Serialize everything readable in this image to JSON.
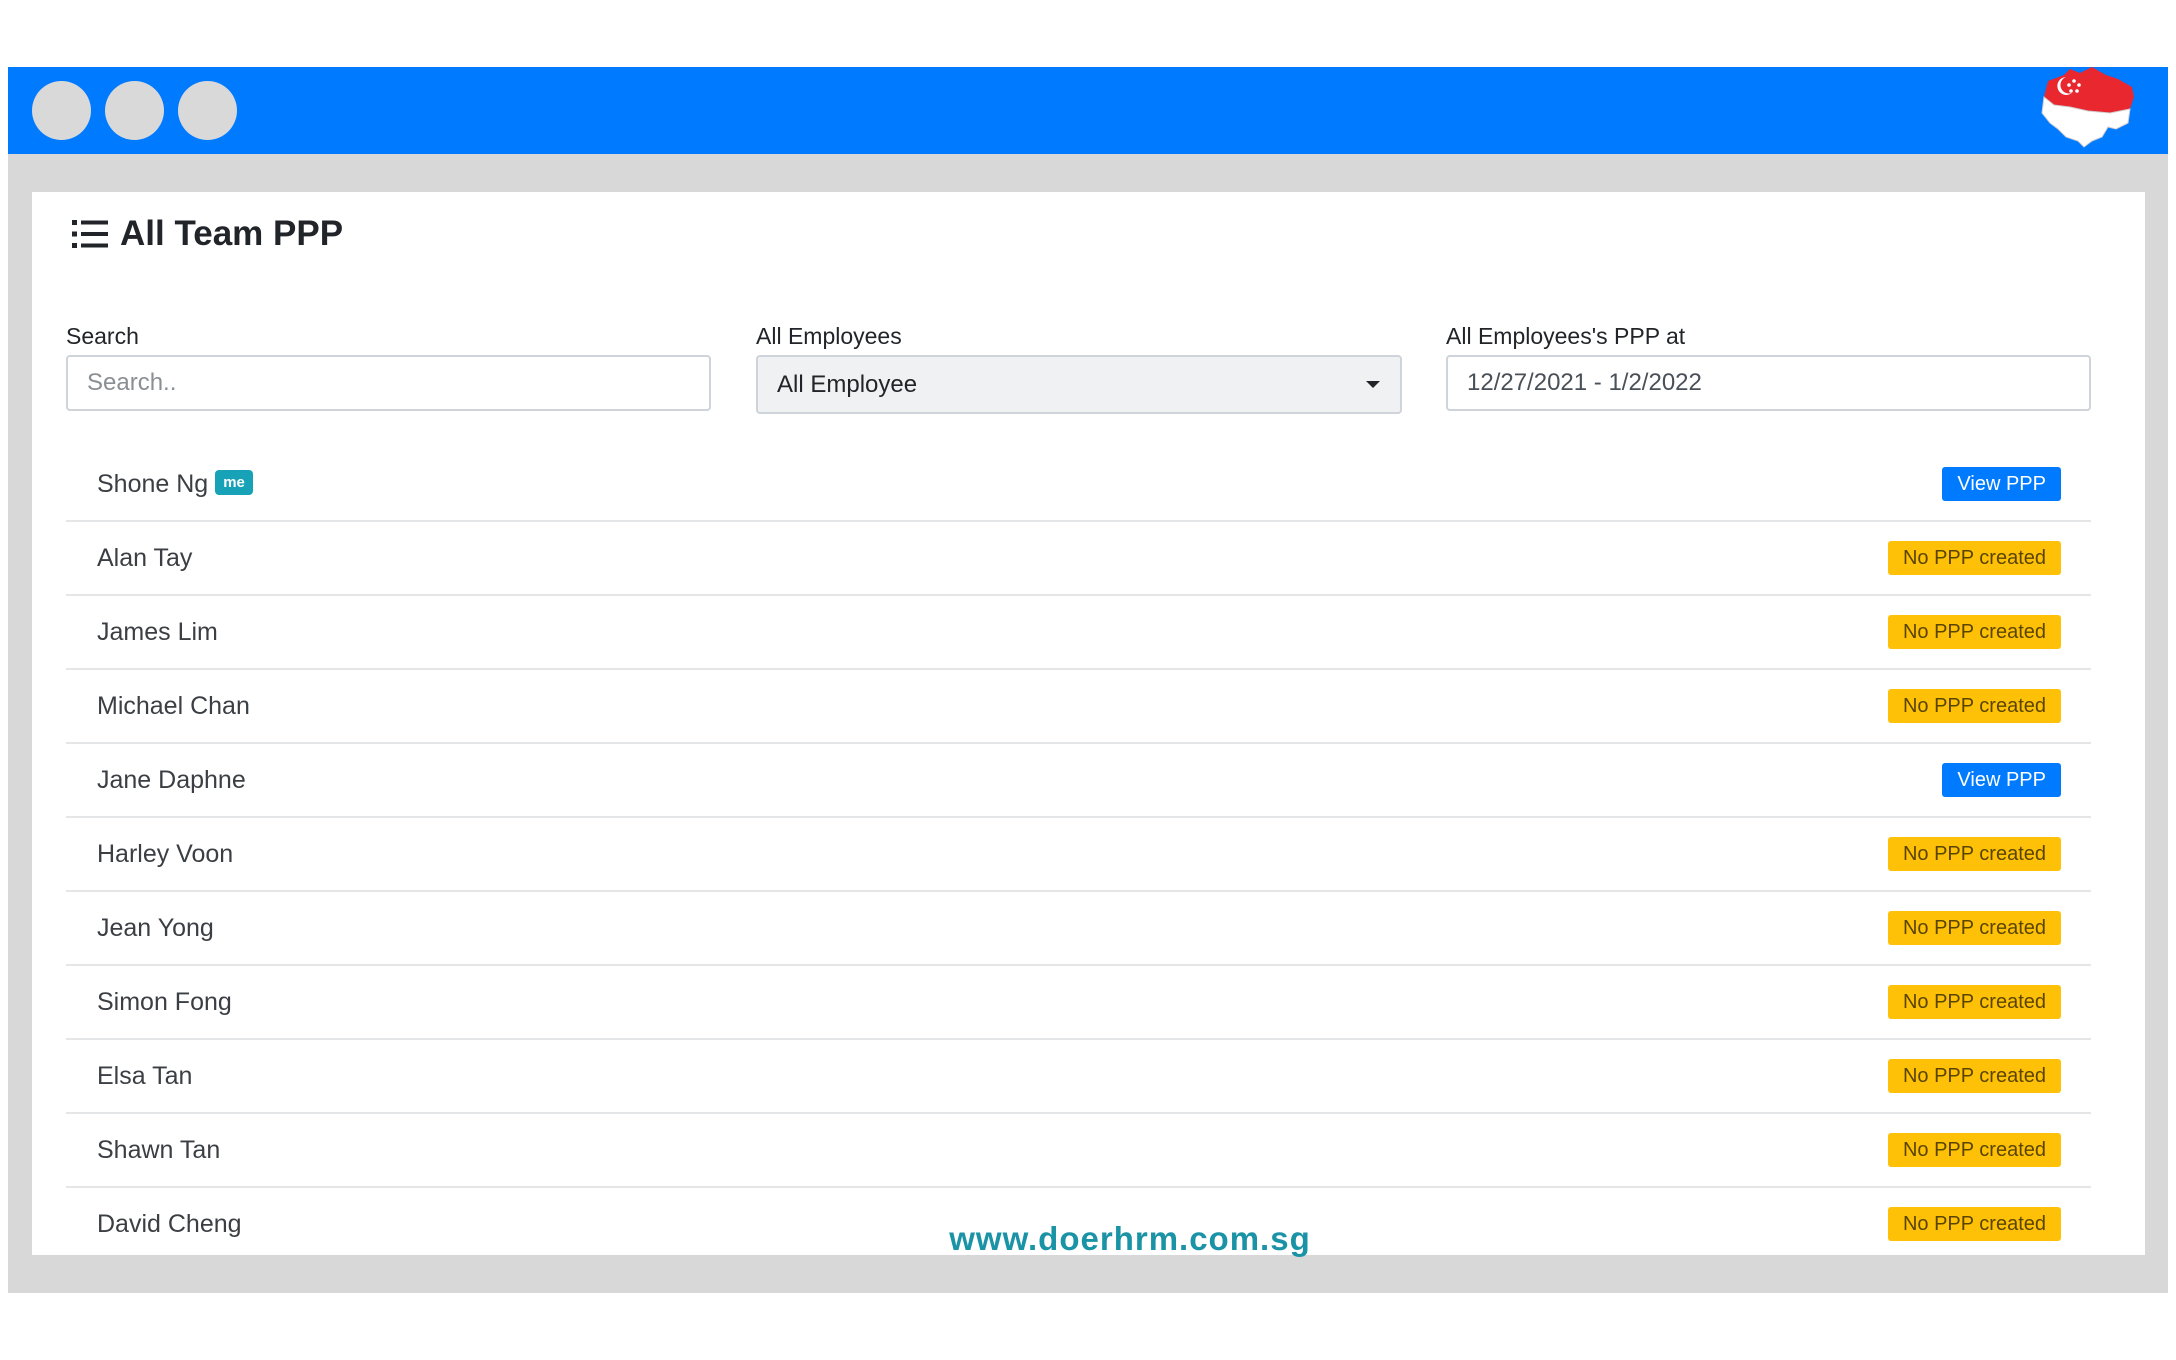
{
  "page": {
    "title": "All Team PPP"
  },
  "filters": {
    "search_label": "Search",
    "search_placeholder": "Search..",
    "employees_label": "All Employees",
    "employees_selected": "All Employee",
    "date_label": "All Employees's PPP at",
    "date_value": "12/27/2021 - 1/2/2022"
  },
  "employees": [
    {
      "name": "Shone Ng",
      "badge": "me",
      "action": "View PPP"
    },
    {
      "name": "Alan Tay",
      "action": "No PPP created"
    },
    {
      "name": "James Lim",
      "action": "No PPP created"
    },
    {
      "name": "Michael Chan",
      "action": "No PPP created"
    },
    {
      "name": "Jane Daphne",
      "action": "View PPP"
    },
    {
      "name": "Harley Voon",
      "action": "No PPP created"
    },
    {
      "name": "Jean Yong",
      "action": "No PPP created"
    },
    {
      "name": "Simon Fong",
      "action": "No PPP created"
    },
    {
      "name": "Elsa Tan",
      "action": "No PPP created"
    },
    {
      "name": "Shawn Tan",
      "action": "No PPP created"
    },
    {
      "name": "David Cheng",
      "action": "No PPP created"
    }
  ],
  "footer": {
    "website": "www.doerhrm.com.sg"
  },
  "colors": {
    "primary": "#007bff",
    "warning": "#ffc107",
    "info": "#17a2b8",
    "frame": "#d8d8d8"
  },
  "icons": {
    "title_icon": "list-icon",
    "flag_icon": "singapore-map-icon"
  }
}
